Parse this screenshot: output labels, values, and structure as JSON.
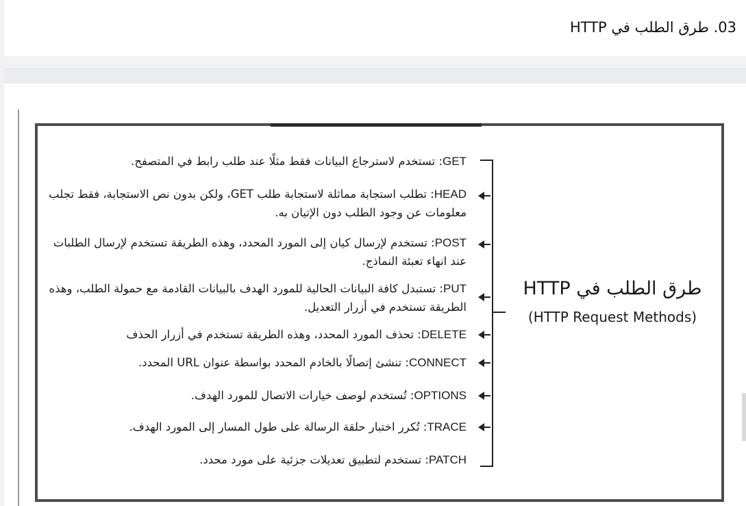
{
  "section_heading": "03. طرق الطلب في HTTP",
  "diagram": {
    "title": "طرق الطلب في HTTP",
    "subtitle": "(HTTP Request Methods)",
    "methods": [
      {
        "name": "GET",
        "description": ": تستخدم لاسترجاع البيانات فقط مثلًا عند طلب رابط في المتصفح."
      },
      {
        "name": "HEAD",
        "description": ": تطلب استجابة مماثلة لاستجابة طلب GET، ولكن بدون نص الاستجابة، فقط تجلب معلومات عن وجود الطلب دون الإتيان به."
      },
      {
        "name": "POST",
        "description": ": تستخدم لإرسال كيان إلى المورد المحدد، وهذه الطريقة تستخدم لإرسال الطلبات عند انهاء تعبئة النماذج."
      },
      {
        "name": "PUT",
        "description": ": تستبدل كافة البيانات الحالية للمورد الهدف بالبيانات القادمة مع حمولة الطلب، وهذه الطريقة تستخدم في أزرار التعديل."
      },
      {
        "name": "DELETE",
        "description": ": تحذف المورد المحدد، وهذه الطريقة تستخدم في أزرار الحذف"
      },
      {
        "name": "CONNECT",
        "description": ": تنشئ إتصالًا بالخادم المحدد بواسطة عنوان URL المحدد."
      },
      {
        "name": "OPTIONS",
        "description": ": تُستخدم لوصف خيارات الاتصال للمورد الهدف."
      },
      {
        "name": "TRACE",
        "description": ": تُكرر اختبار حلقة الرسالة على طول المسار إلى المورد الهدف."
      },
      {
        "name": "PATCH",
        "description": ": تستخدم لتطبيق تعديلات جزئية على مورد محدد."
      }
    ]
  }
}
